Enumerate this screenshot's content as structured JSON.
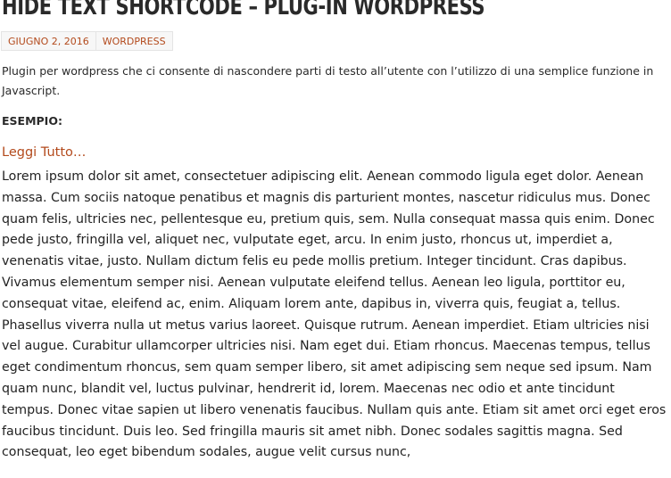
{
  "post": {
    "title": "Hide Text Shortcode – Plug-in WordPress",
    "meta": {
      "date": "Giugno 2, 2016",
      "category": "WordPress"
    },
    "intro": "Plugin per wordpress che ci consente di nascondere parti di testo all’utente con l’utilizzo di una semplice funzione in Javascript.",
    "example_heading": "ESEMPIO:",
    "read_more": "Leggi Tutto…",
    "body": "Lorem ipsum dolor sit amet, consectetuer adipiscing elit. Aenean commodo ligula eget dolor. Aenean massa. Cum sociis natoque penatibus et magnis dis parturient montes, nascetur ridiculus mus. Donec quam felis, ultricies nec, pellentesque eu, pretium quis, sem. Nulla consequat massa quis enim. Donec pede justo, fringilla vel, aliquet nec, vulputate eget, arcu. In enim justo, rhoncus ut, imperdiet a, venenatis vitae, justo. Nullam dictum felis eu pede mollis pretium. Integer tincidunt. Cras dapibus. Vivamus elementum semper nisi. Aenean vulputate eleifend tellus. Aenean leo ligula, porttitor eu, consequat vitae, eleifend ac, enim. Aliquam lorem ante, dapibus in, viverra quis, feugiat a, tellus. Phasellus viverra nulla ut metus varius laoreet. Quisque rutrum. Aenean imperdiet. Etiam ultricies nisi vel augue. Curabitur ullamcorper ultricies nisi. Nam eget dui. Etiam rhoncus. Maecenas tempus, tellus eget condimentum rhoncus, sem quam semper libero, sit amet adipiscing sem neque sed ipsum. Nam quam nunc, blandit vel, luctus pulvinar, hendrerit id, lorem. Maecenas nec odio et ante tincidunt tempus. Donec vitae sapien ut libero venenatis faucibus. Nullam quis ante. Etiam sit amet orci eget eros faucibus tincidunt. Duis leo. Sed fringilla mauris sit amet nibh. Donec sodales sagittis magna. Sed consequat, leo eget bibendum sodales, augue velit cursus nunc,"
  },
  "colors": {
    "accent": "#b34a1c",
    "text": "#222222",
    "meta_background": "#f7f7f7"
  }
}
